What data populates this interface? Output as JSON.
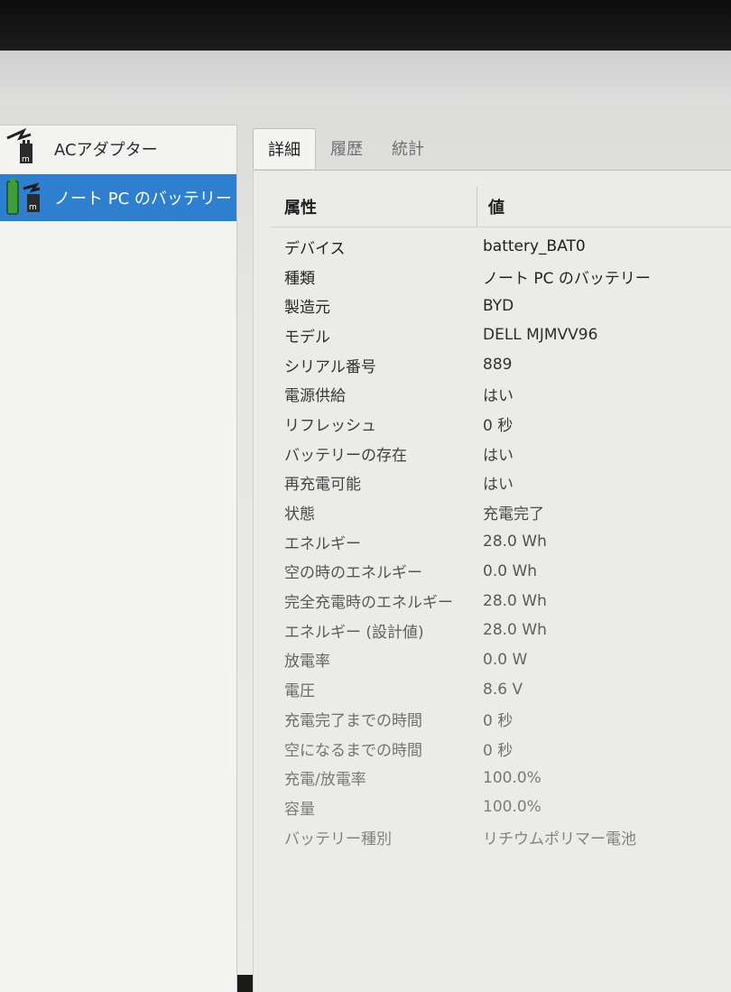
{
  "devices": [
    {
      "label": "ACアダプター",
      "icon": "ac-adapter-icon",
      "selected": false
    },
    {
      "label": "ノート PC のバッテリー",
      "icon": "battery-icon",
      "selected": true
    }
  ],
  "tabs": [
    {
      "label": "詳細",
      "active": true
    },
    {
      "label": "履歴",
      "active": false
    },
    {
      "label": "統計",
      "active": false
    }
  ],
  "table": {
    "header_property": "属性",
    "header_value": "値",
    "rows": [
      {
        "property": "デバイス",
        "value": "battery_BAT0"
      },
      {
        "property": "種類",
        "value": "ノート PC のバッテリー"
      },
      {
        "property": "製造元",
        "value": "BYD"
      },
      {
        "property": "モデル",
        "value": "DELL MJMVV96"
      },
      {
        "property": "シリアル番号",
        "value": "889"
      },
      {
        "property": "電源供給",
        "value": "はい"
      },
      {
        "property": "リフレッシュ",
        "value": "0 秒"
      },
      {
        "property": "バッテリーの存在",
        "value": "はい"
      },
      {
        "property": "再充電可能",
        "value": "はい"
      },
      {
        "property": "状態",
        "value": "充電完了"
      },
      {
        "property": "エネルギー",
        "value": "28.0 Wh"
      },
      {
        "property": "空の時のエネルギー",
        "value": "0.0 Wh"
      },
      {
        "property": "完全充電時のエネルギー",
        "value": "28.0 Wh"
      },
      {
        "property": "エネルギー (設計値)",
        "value": "28.0 Wh"
      },
      {
        "property": "放電率",
        "value": "0.0 W"
      },
      {
        "property": "電圧",
        "value": "8.6 V"
      },
      {
        "property": "充電完了までの時間",
        "value": "0 秒"
      },
      {
        "property": "空になるまでの時間",
        "value": "0 秒"
      },
      {
        "property": "充電/放電率",
        "value": "100.0%"
      },
      {
        "property": "容量",
        "value": "100.0%"
      },
      {
        "property": "バッテリー種別",
        "value": "リチウムポリマー電池"
      }
    ]
  },
  "colors": {
    "selection": "#2f7fd0",
    "battery": "#3f9e3a"
  }
}
